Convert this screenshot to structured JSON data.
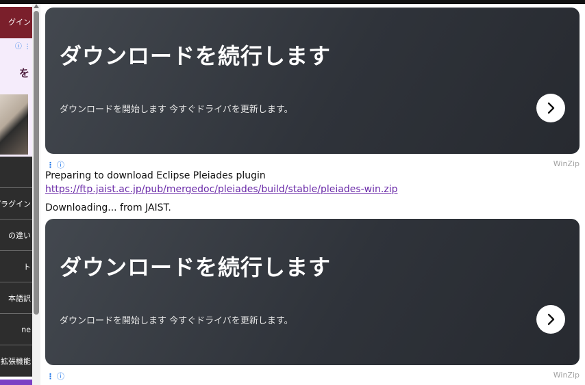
{
  "sidebar": {
    "banner_label": "グイン",
    "ad_text": "を",
    "items": [
      {
        "label": ""
      },
      {
        "label": "プラグイン"
      },
      {
        "label": "の違い"
      },
      {
        "label": "ト"
      },
      {
        "label": "本語訳"
      },
      {
        "label": "ne"
      },
      {
        "label": "拡張機能"
      }
    ]
  },
  "ads": [
    {
      "title": "ダウンロードを続行します",
      "subtitle": "ダウンロードを開始します 今すぐドライバを更新します。",
      "advertiser": "WinZip"
    },
    {
      "title": "ダウンロードを続行します",
      "subtitle": "ダウンロードを開始します 今すぐドライバを更新します。",
      "advertiser": "WinZip"
    }
  ],
  "content": {
    "preparing_text": "Preparing to download Eclipse Pleiades plugin",
    "download_url": "https://ftp.jaist.ac.jp/pub/mergedoc/pleiades/build/stable/pleiades-win.zip",
    "downloading_text": "Downloading... from JAIST."
  },
  "icons": {
    "ad_menu": "⋮",
    "ad_info": "ⓘ"
  },
  "colors": {
    "card_bg": "#2f333a",
    "link": "#6a2aa8",
    "sidebar_banner": "#7a1f2b",
    "sidebar_item": "#2d2d2d"
  }
}
